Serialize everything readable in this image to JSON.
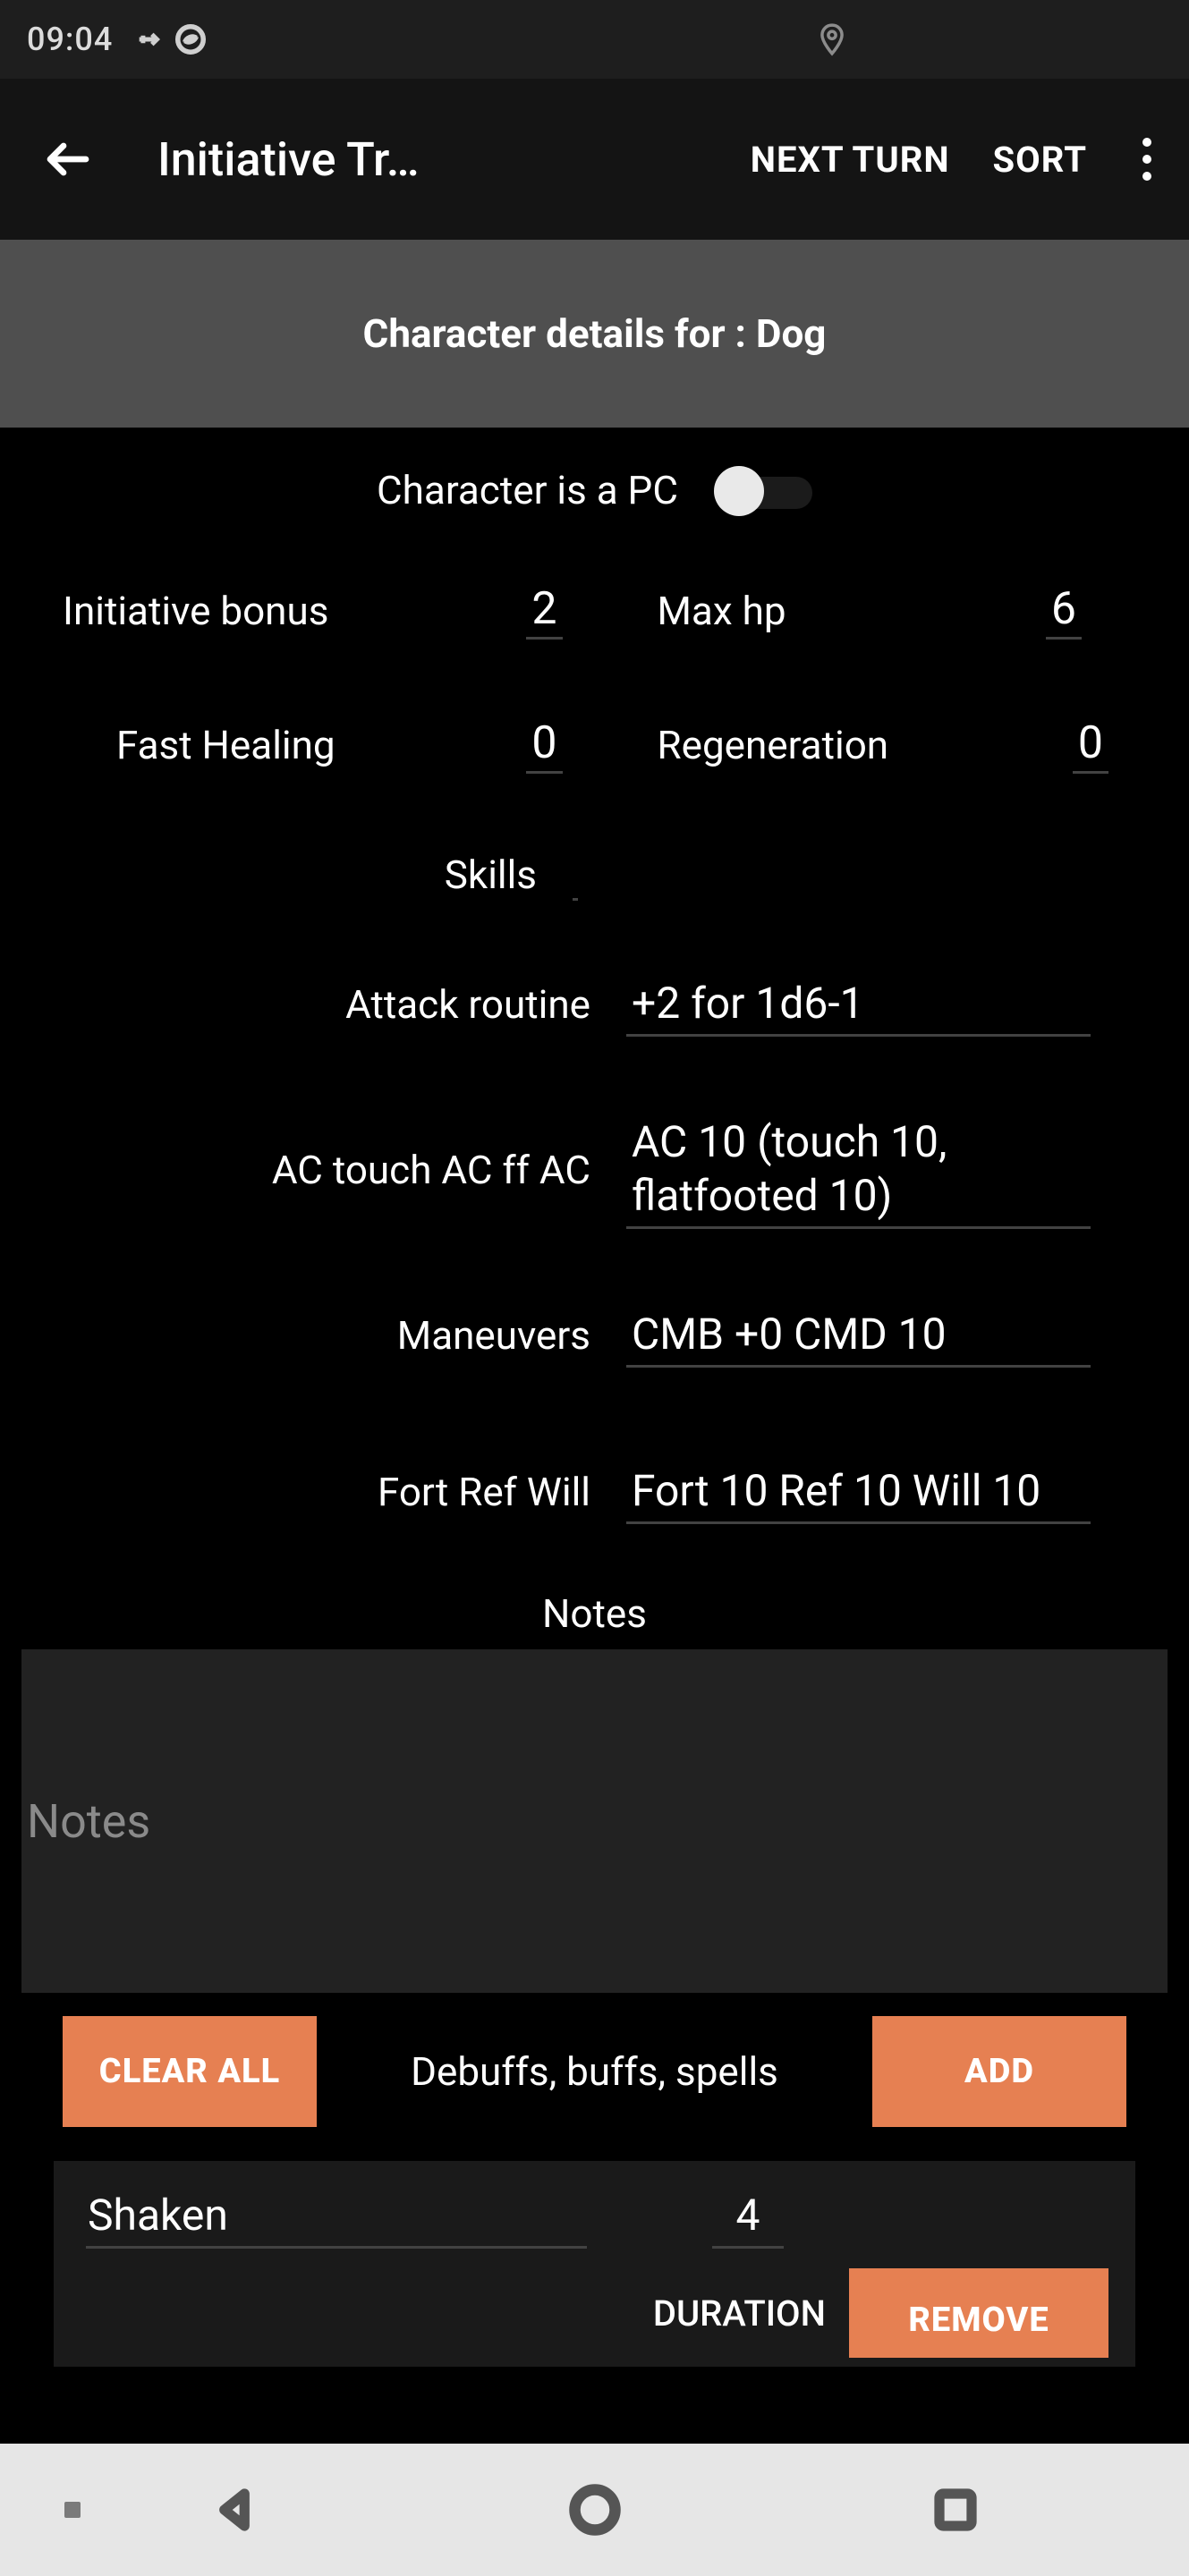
{
  "status_bar": {
    "time": "09:04"
  },
  "app_bar": {
    "title": "Initiative Tr…",
    "next_turn": "NEXT TURN",
    "sort": "SORT"
  },
  "sub_header": "Character details for :  Dog",
  "fields": {
    "pc_label": "Character is a PC",
    "pc_value": false,
    "init_bonus_label": "Initiative bonus",
    "init_bonus_value": "2",
    "max_hp_label": "Max hp",
    "max_hp_value": "6",
    "fast_heal_label": "Fast Healing",
    "fast_heal_value": "0",
    "regen_label": "Regeneration",
    "regen_value": "0",
    "skills_label": "Skills",
    "skills_value": "",
    "attack_label": "Attack routine",
    "attack_value": "+2 for 1d6-1",
    "ac_label": "AC touch AC ff AC",
    "ac_value": "AC 10 (touch 10, flatfooted 10)",
    "maneuvers_label": "Maneuvers",
    "maneuvers_value": "CMB +0 CMD 10",
    "saves_label": "Fort Ref Will",
    "saves_value": "Fort 10 Ref 10 Will 10"
  },
  "notes": {
    "heading": "Notes",
    "placeholder": "Notes",
    "value": ""
  },
  "buffs": {
    "clear_all": "CLEAR ALL",
    "label": "Debuffs, buffs, spells",
    "add": "ADD"
  },
  "effects": [
    {
      "name": "Shaken",
      "duration": "4",
      "duration_label": "DURATION",
      "remove": "REMOVE"
    }
  ],
  "colors": {
    "accent": "#e68052"
  }
}
